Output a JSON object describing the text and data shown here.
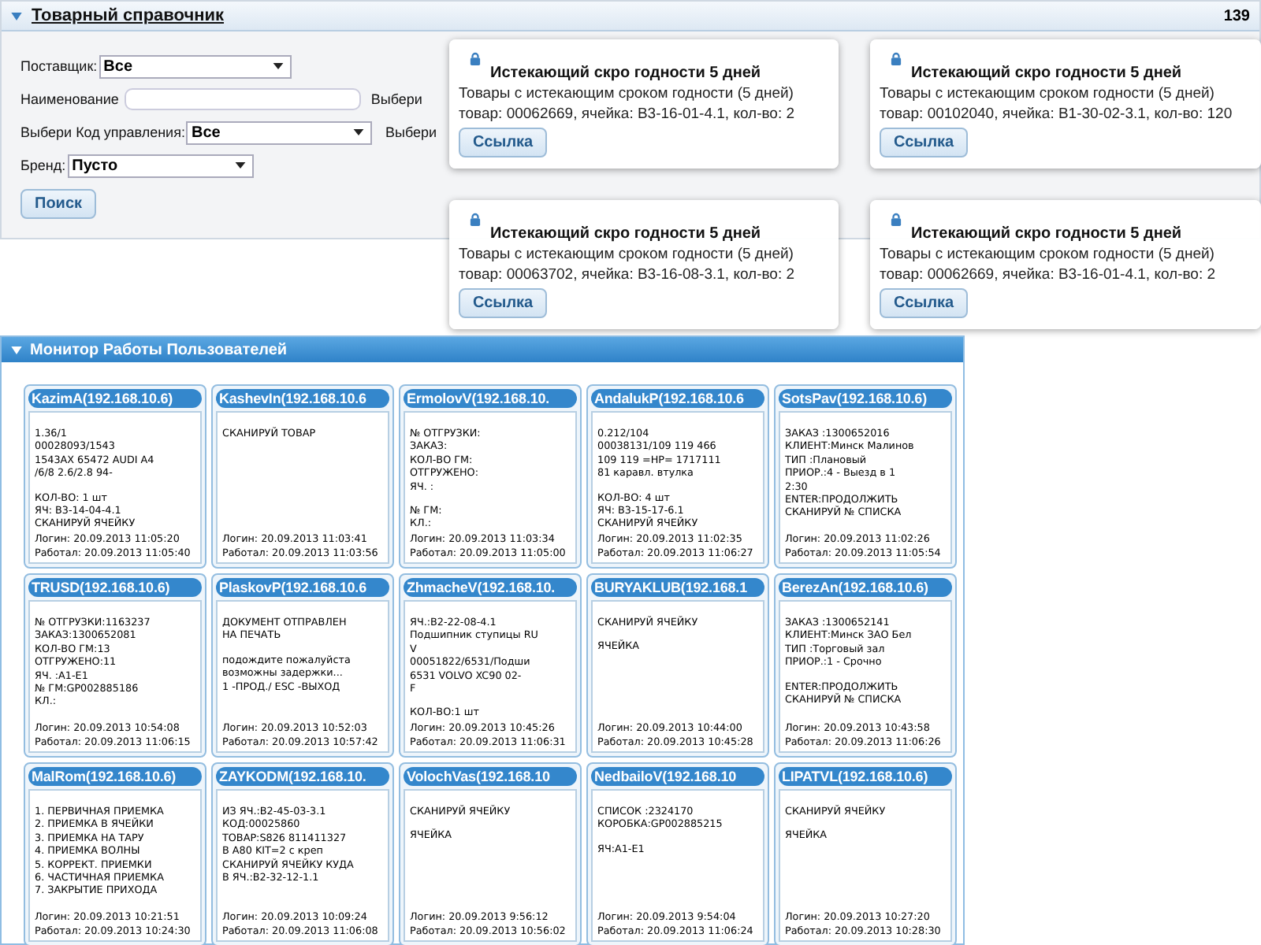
{
  "catalog": {
    "title": "Товарный справочник",
    "count": "139",
    "supplier": {
      "label": "Поставщик:",
      "value": "Все"
    },
    "name": {
      "label": "Наименование"
    },
    "hidden_label_1": "Выбери",
    "control_code": {
      "label": "Выбери Код управления:",
      "value": "Все"
    },
    "hidden_label_2": "Выбери",
    "brand": {
      "label": "Бренд:",
      "value": "Пусто"
    },
    "search_button": "Поиск"
  },
  "notifications": [
    {
      "title": "Истекающий скро годности 5 дней",
      "text": "Товары с истекающим сроком годности (5 дней)",
      "detail": "товар: 00062669, ячейка: В3-16-01-4.1, кол-во: 2",
      "button": "Ссылка"
    },
    {
      "title": "Истекающий скро годности 5 дней",
      "text": "Товары с истекающим сроком годности (5 дней)",
      "detail": "товар: 00102040, ячейка: В1-30-02-3.1, кол-во: 120",
      "button": "Ссылка"
    },
    {
      "title": "Истекающий скро годности 5 дней",
      "text": "Товары с истекающим сроком годности (5 дней)",
      "detail": "товар: 00063702, ячейка: В3-16-08-3.1, кол-во: 2",
      "button": "Ссылка"
    },
    {
      "title": "Истекающий скро годности 5 дней",
      "text": "Товары с истекающим сроком годности (5 дней)",
      "detail": "товар: 00062669, ячейка: В3-16-01-4.1, кол-во: 2",
      "button": "Ссылка"
    }
  ],
  "monitor": {
    "title": "Монитор Работы Пользователей",
    "users": [
      {
        "name": "KazimA(192.168.10.6)",
        "blocks": [
          [
            "1.36/1",
            "00028093/1543",
            "1543AX 65472 AUDI A4",
            "/6/8 2.6/2.8 94-"
          ],
          [
            "КОЛ-ВО: 1 шт",
            "ЯЧ: В3-14-04-4.1",
            "СКАНИРУЙ ЯЧЕЙКУ"
          ]
        ],
        "login": "Логин: 20.09.2013 11:05:20",
        "worked": "Работал: 20.09.2013 11:05:40"
      },
      {
        "name": "KashevIn(192.168.10.6",
        "blocks": [
          [
            "СКАНИРУЙ ТОВАР"
          ]
        ],
        "login": "Логин: 20.09.2013 11:03:41",
        "worked": "Работал: 20.09.2013 11:03:56"
      },
      {
        "name": "ErmolovV(192.168.10.",
        "blocks": [
          [
            "№ ОТГРУЗКИ:",
            "ЗАКАЗ:",
            "КОЛ-ВО ГМ:",
            "ОТГРУЖЕНО:",
            "ЯЧ. :"
          ],
          [
            "№ ГМ:",
            "КЛ.:"
          ]
        ],
        "login": "Логин: 20.09.2013 11:03:34",
        "worked": "Работал: 20.09.2013 11:05:00"
      },
      {
        "name": "AndalukP(192.168.10.6",
        "blocks": [
          [
            "0.212/104",
            "00038131/109 119 466",
            "109 119 =HP= 1717111",
            "81 каравл. втулка"
          ],
          [
            "КОЛ-ВО: 4 шт",
            "ЯЧ: В3-15-17-6.1",
            "СКАНИРУЙ ЯЧЕЙКУ"
          ]
        ],
        "login": "Логин: 20.09.2013 11:02:35",
        "worked": "Работал: 20.09.2013 11:06:27"
      },
      {
        "name": "SotsPav(192.168.10.6)",
        "blocks": [
          [
            "ЗАКАЗ :1300652016",
            "КЛИЕНТ:Минск Малинов",
            "ТИП :Плановый",
            "ПРИОР.:4 - Выезд в 1",
            "2:30",
            "ENTER:ПРОДОЛЖИТЬ",
            "СКАНИРУЙ № СПИСКА"
          ]
        ],
        "login": "Логин: 20.09.2013 11:02:26",
        "worked": "Работал: 20.09.2013 11:05:54"
      },
      {
        "name": "TRUSD(192.168.10.6)",
        "blocks": [
          [
            "№ ОТГРУЗКИ:1163237",
            "ЗАКАЗ:1300652081",
            "КОЛ-ВО ГМ:13",
            "ОТГРУЖЕНО:11",
            "ЯЧ. :А1-Е1",
            "№ ГМ:GP002885186",
            "КЛ.:"
          ]
        ],
        "login": "Логин: 20.09.2013 10:54:08",
        "worked": "Работал: 20.09.2013 11:06:15"
      },
      {
        "name": "PlaskovP(192.168.10.6",
        "blocks": [
          [
            "ДОКУМЕНТ ОТПРАВЛЕН",
            "НА ПЕЧАТЬ"
          ],
          [
            "подождите пожалуйста",
            "возможны задержки...",
            "1 -ПРОД./ ESC -ВЫХОД"
          ]
        ],
        "login": "Логин: 20.09.2013 10:52:03",
        "worked": "Работал: 20.09.2013 10:57:42"
      },
      {
        "name": "ZhmacheV(192.168.10.",
        "blocks": [
          [
            "ЯЧ.:В2-22-08-4.1",
            "Подшипник ступицы RU",
            "V",
            "00051822/6531/Подши",
            "6531 VOLVO XC90 02-",
            "F"
          ],
          [
            "КОЛ-ВО:1 шт"
          ]
        ],
        "login": "Логин: 20.09.2013 10:45:26",
        "worked": "Работал: 20.09.2013 11:06:31"
      },
      {
        "name": "BURYAKLUB(192.168.1",
        "blocks": [
          [
            "СКАНИРУЙ ЯЧЕЙКУ"
          ],
          [
            "ЯЧЕЙКА"
          ]
        ],
        "login": "Логин: 20.09.2013 10:44:00",
        "worked": "Работал: 20.09.2013 10:45:28"
      },
      {
        "name": "BerezAn(192.168.10.6)",
        "blocks": [
          [
            "ЗАКАЗ :1300652141",
            "КЛИЕНТ:Минск ЗАО Бел",
            "ТИП :Торговый зал",
            "ПРИОР.:1 - Срочно"
          ],
          [
            "ENTER:ПРОДОЛЖИТЬ",
            "СКАНИРУЙ № СПИСКА"
          ]
        ],
        "login": "Логин: 20.09.2013 10:43:58",
        "worked": "Работал: 20.09.2013 11:06:26"
      },
      {
        "name": "MalRom(192.168.10.6)",
        "blocks": [
          [
            "1. ПЕРВИЧНАЯ ПРИЕМКА",
            "2. ПРИЕМКА В ЯЧЕЙКИ",
            "3. ПРИЕМКА НА ТАРУ",
            "4. ПРИЕМКА ВОЛНЫ",
            "5. КОРРЕКТ. ПРИЕМКИ",
            "6. ЧАСТИЧНАЯ ПРИЕМКА",
            "7. ЗАКРЫТИЕ ПРИХОДА"
          ]
        ],
        "login": "Логин: 20.09.2013 10:21:51",
        "worked": "Работал: 20.09.2013 10:24:30"
      },
      {
        "name": "ZAYKODM(192.168.10.",
        "blocks": [
          [
            "ИЗ ЯЧ.:В2-45-03-3.1",
            "КОД:00025860",
            "ТОВАР:S826 811411327",
            "В А80 KIT=2 с креп",
            "СКАНИРУЙ ЯЧЕЙКУ КУДА",
            "В ЯЧ.:В2-32-12-1.1"
          ]
        ],
        "login": "Логин: 20.09.2013 10:09:24",
        "worked": "Работал: 20.09.2013 11:06:08"
      },
      {
        "name": "VolochVas(192.168.10",
        "blocks": [
          [
            "СКАНИРУЙ ЯЧЕЙКУ"
          ],
          [
            "ЯЧЕЙКА"
          ]
        ],
        "login": "Логин: 20.09.2013 9:56:12",
        "worked": "Работал: 20.09.2013 10:56:02"
      },
      {
        "name": "NedbailoV(192.168.10",
        "blocks": [
          [
            "СПИСОК :2324170",
            "КОРОБКА:GP002885215"
          ],
          [
            "ЯЧ:А1-Е1"
          ]
        ],
        "login": "Логин: 20.09.2013 9:54:04",
        "worked": "Работал: 20.09.2013 11:06:24"
      },
      {
        "name": "LIPATVL(192.168.10.6)",
        "blocks": [
          [
            "СКАНИРУЙ ЯЧЕЙКУ"
          ],
          [
            "ЯЧЕЙКА"
          ]
        ],
        "login": "Логин: 20.09.2013 10:27:20",
        "worked": "Работал: 20.09.2013 10:28:30"
      }
    ]
  }
}
